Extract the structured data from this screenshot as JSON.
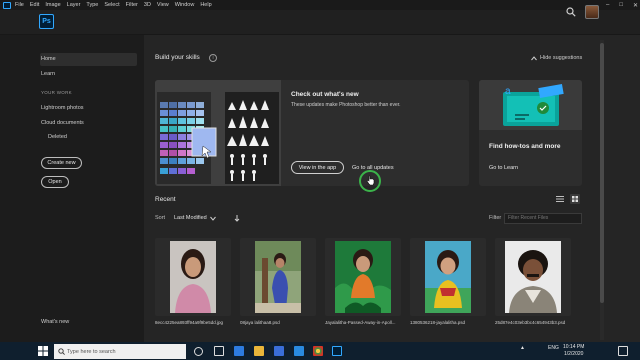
{
  "menubar": {
    "items": [
      "File",
      "Edit",
      "Image",
      "Layer",
      "Type",
      "Select",
      "Filter",
      "3D",
      "View",
      "Window",
      "Help"
    ]
  },
  "app": {
    "logo": "Ps"
  },
  "sidebar": {
    "home": "Home",
    "learn": "Learn",
    "your_work_header": "YOUR WORK",
    "lightroom": "Lightroom photos",
    "cloud": "Cloud documents",
    "deleted": "Deleted",
    "create_new": "Create new",
    "open": "Open",
    "whats_new": "What's new"
  },
  "skills": {
    "title": "Build your skills",
    "info": "i",
    "hide": "Hide suggestions"
  },
  "card_main": {
    "title": "Check out what's new",
    "desc": "These updates make Photoshop better than ever.",
    "view_btn": "View in the app",
    "go_link": "Go to all updates"
  },
  "card_side": {
    "title": "Find how-tos and more",
    "link": "Go to Learn"
  },
  "recent": {
    "title": "Recent",
    "sort_label": "Sort",
    "sort_value": "Last Modified",
    "filter_label": "Filter",
    "filter_placeholder": "Filter Recent Files",
    "files": [
      {
        "name": "8ecc4225ea893ff94a9f9be5dd.jpg",
        "sub": ""
      },
      {
        "name": "08jaya lalithaa8.psd",
        "sub": ""
      },
      {
        "name": "Jayalalitha-Passed-Away-in-Apoll...",
        "sub": ""
      },
      {
        "name": "1380536218-jayalalitha.psd",
        "sub": ""
      },
      {
        "name": "25d87e4c03eb3bc4c654943b3.psd",
        "sub": ""
      }
    ]
  },
  "taskbar": {
    "search_placeholder": "Type here to search",
    "lang": "ENG",
    "time": "10:14 PM",
    "date": "1/2/2020"
  },
  "colors": {
    "accent": "#31a8ff",
    "cursor_ring": "#3bb34a",
    "learn_teal": "#0aa39b"
  },
  "icons": {
    "search": "search-icon",
    "info": "info-icon",
    "chevron": "chevron-up-icon",
    "sort_dir": "arrow-down-icon",
    "list_view": "list-view-icon",
    "grid_view": "grid-view-icon"
  }
}
